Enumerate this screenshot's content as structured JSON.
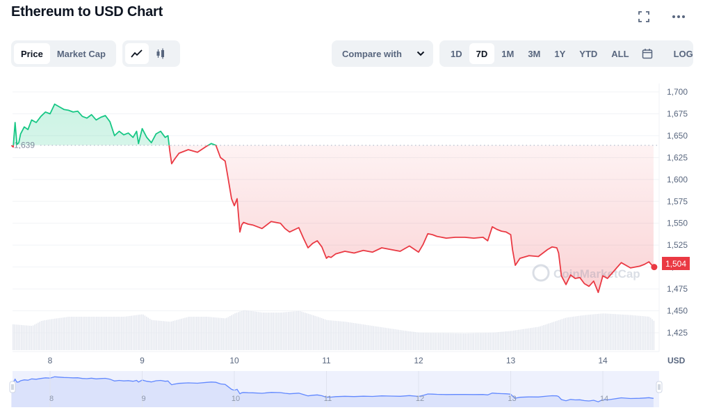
{
  "header": {
    "title": "Ethereum to USD Chart",
    "fullscreen_icon": "fullscreen-icon",
    "more_icon": "more-horizontal-icon"
  },
  "toolbar": {
    "metric_tabs": [
      {
        "label": "Price",
        "active": true
      },
      {
        "label": "Market Cap",
        "active": false
      }
    ],
    "chart_type_tabs": [
      {
        "icon": "line-chart-icon",
        "active": true
      },
      {
        "icon": "candlestick-icon",
        "active": false
      }
    ],
    "compare_label": "Compare with",
    "ranges": [
      {
        "label": "1D",
        "active": false
      },
      {
        "label": "7D",
        "active": true
      },
      {
        "label": "1M",
        "active": false
      },
      {
        "label": "3M",
        "active": false
      },
      {
        "label": "1Y",
        "active": false
      },
      {
        "label": "YTD",
        "active": false
      },
      {
        "label": "ALL",
        "active": false
      }
    ],
    "calendar_icon": "calendar-icon",
    "log_label": "LOG"
  },
  "colors": {
    "up": "#16c784",
    "down": "#ea3943",
    "navigator": "#6188ff"
  },
  "watermark": "CoinMarketCap",
  "chart_data": {
    "type": "line",
    "title": "Ethereum to USD Chart",
    "xlabel": "",
    "ylabel": "USD",
    "currency_label": "USD",
    "reference_price": 1639,
    "reference_label": "1,639",
    "current_price": 1504,
    "current_label": "1,504",
    "ylim": [
      1415,
      1708
    ],
    "xlim": [
      7.58,
      14.55
    ],
    "y_ticks": [
      1700,
      1675,
      1650,
      1625,
      1600,
      1575,
      1550,
      1525,
      1500,
      1475,
      1450,
      1425
    ],
    "y_tick_labels": [
      "1,700",
      "1,675",
      "1,650",
      "1,625",
      "1,600",
      "1,575",
      "1,550",
      "1,525",
      "1,500",
      "1,475",
      "1,450",
      "1,425"
    ],
    "x_ticks": [
      8,
      9,
      10,
      11,
      12,
      13,
      14
    ],
    "x_tick_labels": [
      "8",
      "9",
      "10",
      "11",
      "12",
      "13",
      "14"
    ],
    "grid": true,
    "legend": "none",
    "series": [
      {
        "name": "Price",
        "x": [
          7.58,
          7.6,
          7.62,
          7.64,
          7.66,
          7.68,
          7.72,
          7.76,
          7.8,
          7.85,
          7.9,
          7.95,
          8.0,
          8.05,
          8.1,
          8.15,
          8.2,
          8.25,
          8.3,
          8.35,
          8.4,
          8.45,
          8.5,
          8.55,
          8.6,
          8.65,
          8.7,
          8.75,
          8.8,
          8.85,
          8.9,
          8.94,
          8.96,
          9.0,
          9.05,
          9.1,
          9.15,
          9.2,
          9.25,
          9.28,
          9.3,
          9.32,
          9.35,
          9.4,
          9.5,
          9.6,
          9.7,
          9.75,
          9.8,
          9.85,
          9.9,
          9.93,
          9.97,
          10.0,
          10.03,
          10.06,
          10.08,
          10.1,
          10.15,
          10.2,
          10.3,
          10.4,
          10.5,
          10.55,
          10.6,
          10.7,
          10.75,
          10.8,
          10.85,
          10.9,
          10.95,
          11.0,
          11.02,
          11.05,
          11.1,
          11.2,
          11.3,
          11.4,
          11.5,
          11.6,
          11.7,
          11.8,
          11.9,
          12.0,
          12.05,
          12.1,
          12.15,
          12.2,
          12.3,
          12.4,
          12.5,
          12.6,
          12.7,
          12.75,
          12.8,
          12.85,
          12.9,
          12.95,
          13.0,
          13.02,
          13.05,
          13.1,
          13.2,
          13.3,
          13.4,
          13.45,
          13.5,
          13.52,
          13.55,
          13.6,
          13.65,
          13.7,
          13.75,
          13.8,
          13.85,
          13.9,
          13.95,
          14.0,
          14.05,
          14.1,
          14.2,
          14.3,
          14.4,
          14.45,
          14.5,
          14.55
        ],
        "values": [
          1639,
          1637,
          1665,
          1640,
          1642,
          1652,
          1660,
          1657,
          1668,
          1665,
          1672,
          1677,
          1675,
          1686,
          1683,
          1680,
          1679,
          1677,
          1678,
          1672,
          1670,
          1674,
          1668,
          1671,
          1673,
          1666,
          1650,
          1655,
          1651,
          1653,
          1648,
          1655,
          1641,
          1658,
          1648,
          1642,
          1652,
          1655,
          1648,
          1650,
          1632,
          1618,
          1623,
          1630,
          1634,
          1631,
          1638,
          1641,
          1639,
          1625,
          1621,
          1603,
          1578,
          1570,
          1578,
          1540,
          1548,
          1551,
          1549,
          1548,
          1544,
          1552,
          1550,
          1544,
          1540,
          1545,
          1533,
          1522,
          1527,
          1530,
          1523,
          1510,
          1512,
          1511,
          1515,
          1518,
          1516,
          1519,
          1517,
          1522,
          1520,
          1518,
          1524,
          1517,
          1526,
          1538,
          1537,
          1535,
          1533,
          1534,
          1534,
          1533,
          1534,
          1530,
          1546,
          1543,
          1541,
          1540,
          1537,
          1520,
          1502,
          1510,
          1513,
          1512,
          1520,
          1523,
          1522,
          1516,
          1490,
          1480,
          1491,
          1487,
          1488,
          1481,
          1478,
          1484,
          1471,
          1490,
          1487,
          1493,
          1505,
          1499,
          1501,
          1503,
          1506,
          1500,
          1504,
          1504
        ]
      },
      {
        "name": "Volume",
        "x": [
          7.58,
          7.8,
          7.9,
          8.0,
          8.2,
          8.5,
          8.8,
          9.0,
          9.1,
          9.3,
          9.5,
          9.7,
          9.9,
          10.0,
          10.1,
          10.3,
          10.5,
          10.7,
          10.9,
          11.0,
          11.2,
          11.5,
          11.8,
          12.0,
          12.5,
          12.8,
          13.0,
          13.3,
          13.6,
          13.8,
          14.0,
          14.3,
          14.5,
          14.55
        ],
        "values": [
          0.62,
          0.58,
          0.7,
          0.74,
          0.8,
          0.8,
          0.8,
          0.86,
          0.72,
          0.68,
          0.8,
          0.8,
          0.76,
          0.88,
          0.96,
          0.9,
          0.9,
          0.94,
          0.8,
          0.72,
          0.68,
          0.58,
          0.48,
          0.42,
          0.4,
          0.42,
          0.46,
          0.56,
          0.78,
          0.84,
          0.88,
          0.84,
          0.8,
          0.7
        ]
      }
    ]
  },
  "navigator": {
    "x_tick_labels": [
      "8",
      "9",
      "10",
      "11",
      "12",
      "13",
      "14"
    ],
    "left_handle_icon": "drag-handle-icon",
    "right_handle_icon": "drag-handle-icon"
  }
}
